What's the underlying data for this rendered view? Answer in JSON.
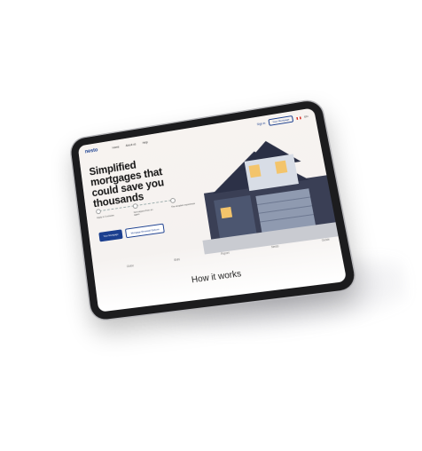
{
  "nav": {
    "logo": "nesto",
    "links": [
      "Home",
      "About us",
      "Help"
    ],
    "sign_in": "Sign in",
    "cta": "Your Mortgage",
    "lang": "EN"
  },
  "hero": {
    "title_part1": "Simplified ",
    "title_highlight": "mortgages",
    "title_part2": " that could save you thousands",
    "steps": [
      "Apply in 3 minutes",
      "Get support from an agent",
      "The simplest experience"
    ],
    "primary_button": "Your Mortgage",
    "secondary_button": "Mortgage Renewal Options"
  },
  "press": [
    "Globe",
    "BNN",
    "Report",
    "Nesto",
    "Guide"
  ],
  "section": {
    "heading_part1": "How it ",
    "heading_highlight": "works"
  },
  "colors": {
    "brand": "#1b3f8f",
    "accent": "#5ec9c0",
    "bezel": "#1c1c1e"
  }
}
